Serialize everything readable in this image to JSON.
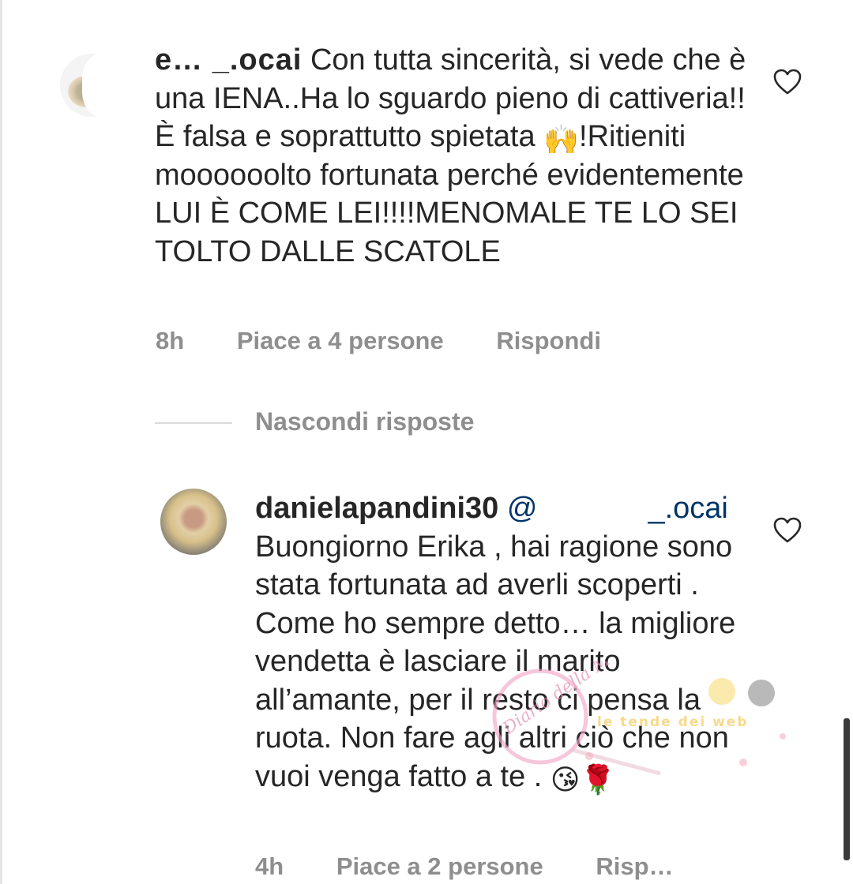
{
  "comment1": {
    "username_visible": "e… _.ocai",
    "text": "Con tutta sincerità, si vede che è una IENA..Ha lo sguardo pieno di cattiveria!!È falsa e soprattutto spietata ",
    "emoji": "🙌",
    "text_after_emoji": "!Ritieniti moooooolto fortunata perché evidentemente LUI È COME LEI!!!!MENOMALE TE LO SEI TOLTO DALLE SCATOLE",
    "time": "8h",
    "likes": "Piace a 4 persone",
    "reply": "Rispondi"
  },
  "thread": {
    "hide_replies": "Nascondi risposte"
  },
  "comment2": {
    "username": "danielapandini30",
    "mention_prefix": "@",
    "mention_visible": "_.ocai",
    "text": "Buongiorno Erika , hai ragione sono stata fortunata ad averli scoperti . Come ho sempre detto… la migliore vendetta è lasciare il marito all’amante, per il resto ci pensa la ruota. Non fare agli altri ciò che non vuoi venga fatto a te . ",
    "emoji1": "😘",
    "emoji2": "🌹",
    "time": "4h",
    "likes": "Piace a 2 persone",
    "reply": "Risp…"
  },
  "watermark": {
    "text1": "Diario della Musa",
    "text2": "le tende dei web"
  }
}
